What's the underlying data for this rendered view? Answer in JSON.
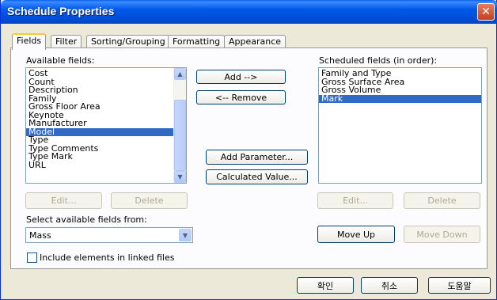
{
  "window": {
    "title": "Schedule Properties",
    "close_glyph": "✕"
  },
  "tabs": [
    {
      "label": "Fields",
      "active": true
    },
    {
      "label": "Filter",
      "active": false
    },
    {
      "label": "Sorting/Grouping",
      "active": false
    },
    {
      "label": "Formatting",
      "active": false
    },
    {
      "label": "Appearance",
      "active": false
    }
  ],
  "available": {
    "label": "Available fields:",
    "items": [
      "Cost",
      "Count",
      "Description",
      "Family",
      "Gross Floor Area",
      "Keynote",
      "Manufacturer",
      "Model",
      "Type",
      "Type Comments",
      "Type Mark",
      "URL"
    ],
    "selected_index": 7,
    "edit_label": "Edit...",
    "delete_label": "Delete"
  },
  "middle": {
    "add_label": "Add -->",
    "remove_label": "<-- Remove",
    "add_parameter_label": "Add Parameter...",
    "calculated_value_label": "Calculated Value..."
  },
  "scheduled": {
    "label": "Scheduled fields (in order):",
    "items": [
      "Family and Type",
      "Gross Surface Area",
      "Gross Volume",
      "Mark"
    ],
    "selected_index": 3,
    "edit_label": "Edit...",
    "delete_label": "Delete",
    "move_up_label": "Move Up",
    "move_down_label": "Move Down"
  },
  "select_from": {
    "label": "Select available fields from:",
    "value": "Mass"
  },
  "include_linked": {
    "label": "Include elements in linked files",
    "checked": false
  },
  "footer": {
    "ok_label": "확인",
    "cancel_label": "취소",
    "help_label": "도움말"
  },
  "icons": {
    "scroll_up": "up-arrow-icon",
    "scroll_down": "down-arrow-icon",
    "combo_arrow": "chevron-down-icon"
  },
  "colors": {
    "selection": "#316AC5",
    "titlebar": "#0054E3",
    "dialog_bg": "#ECE9D8",
    "close_button": "#D8552F"
  }
}
